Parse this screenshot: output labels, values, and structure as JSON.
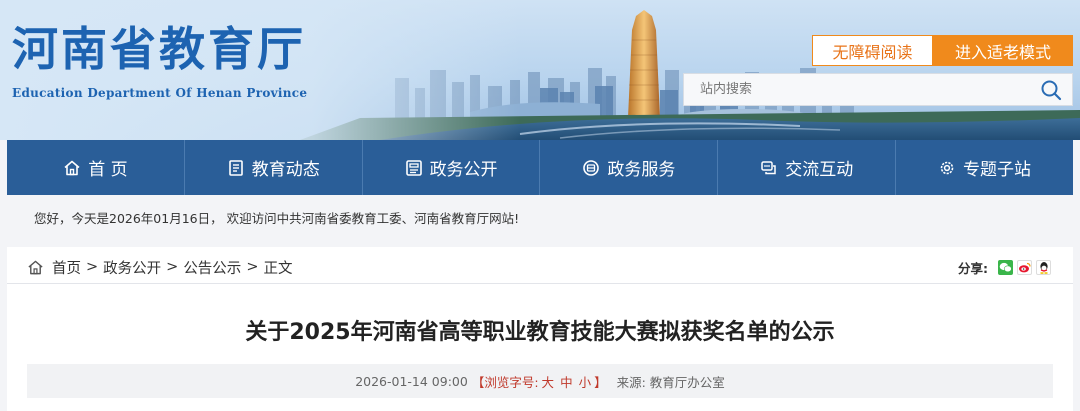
{
  "header": {
    "title": "河南省教育厅",
    "subtitle": "Education Department Of Henan Province",
    "accessible_label": "无障碍阅读",
    "elder_label": "进入适老模式",
    "search_placeholder": "站内搜索"
  },
  "nav": {
    "items": [
      {
        "label": "首 页",
        "icon": "home-icon"
      },
      {
        "label": "教育动态",
        "icon": "news-icon"
      },
      {
        "label": "政务公开",
        "icon": "document-icon"
      },
      {
        "label": "政务服务",
        "icon": "service-icon"
      },
      {
        "label": "交流互动",
        "icon": "chat-icon"
      },
      {
        "label": "专题子站",
        "icon": "gear-icon"
      }
    ]
  },
  "notice": {
    "text": "您好，今天是2026年01月16日， 欢迎访问中共河南省委教育工委、河南省教育厅网站!"
  },
  "breadcrumb": {
    "home": "首页",
    "level1": "政务公开",
    "level2": "公告公示",
    "current": "正文",
    "sep": ">"
  },
  "share": {
    "label": "分享:",
    "icons": [
      "wechat-icon",
      "weibo-icon",
      "qq-icon"
    ]
  },
  "article": {
    "title": "关于2025年河南省高等职业教育技能大赛拟获奖名单的公示",
    "date": "2026-01-14 09:00",
    "font_size_prefix": "【浏览字号:",
    "font_large": "大",
    "font_medium": "中",
    "font_small": "小",
    "font_size_suffix": "】",
    "source": "来源: 教育厅办公室"
  },
  "colors": {
    "nav_bg": "#2a5e98",
    "brand_blue": "#1d63b1",
    "accent_orange": "#f08a1c"
  }
}
